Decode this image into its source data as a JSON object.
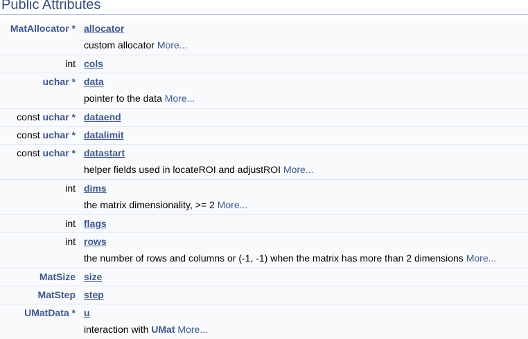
{
  "section_title": "Public Attributes",
  "more_label": "More...",
  "members": [
    {
      "prefix": "",
      "type": "MatAllocator *",
      "name": "allocator",
      "desc": "custom allocator ",
      "more": "More..."
    },
    {
      "prefix": "",
      "type": "int",
      "name": "cols"
    },
    {
      "prefix": "",
      "type": "uchar *",
      "name": "data",
      "desc": "pointer to the data ",
      "more": "More..."
    },
    {
      "prefix": "const ",
      "type": "uchar *",
      "name": "dataend"
    },
    {
      "prefix": "const ",
      "type": "uchar *",
      "name": "datalimit"
    },
    {
      "prefix": "const ",
      "type": "uchar *",
      "name": "datastart",
      "desc": "helper fields used in locateROI and adjustROI ",
      "more": "More..."
    },
    {
      "prefix": "",
      "type": "int",
      "name": "dims",
      "desc": "the matrix dimensionality, >= 2 ",
      "more": "More..."
    },
    {
      "prefix": "",
      "type": "int",
      "name": "flags"
    },
    {
      "prefix": "",
      "type": "int",
      "name": "rows",
      "desc": "the number of rows and columns or (-1, -1) when the matrix has more than 2 dimensions ",
      "more": "More..."
    },
    {
      "prefix": "",
      "type": "MatSize",
      "name": "size"
    },
    {
      "prefix": "",
      "type": "MatStep",
      "name": "step"
    },
    {
      "prefix": "",
      "type": "UMatData *",
      "name": "u",
      "desc": "interaction with ",
      "desc_link": "UMat",
      "more": "More..."
    }
  ]
}
